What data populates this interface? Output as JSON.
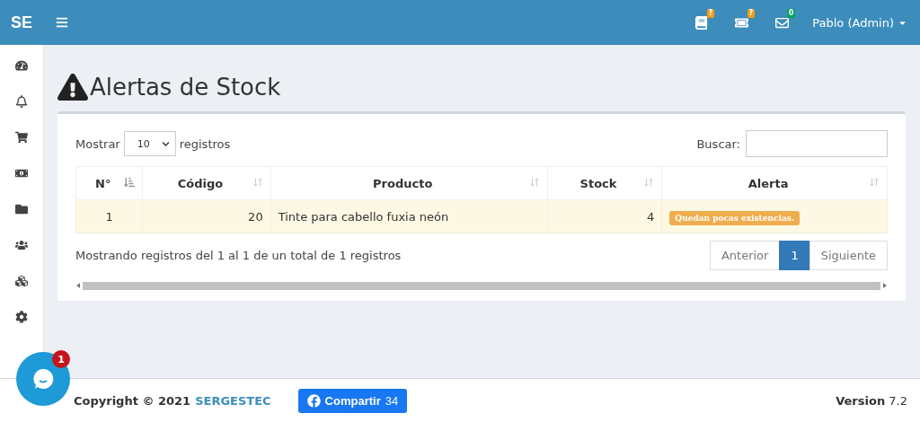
{
  "header": {
    "logo": "SE",
    "notifications": [
      {
        "kind": "book",
        "badge": "?",
        "color": "#f39c12"
      },
      {
        "kind": "ticket",
        "badge": "?",
        "color": "#f39c12"
      },
      {
        "kind": "mail",
        "badge": "0",
        "color": "#00a65a"
      }
    ],
    "user": "Pablo (Admin)"
  },
  "sidebar": {
    "items": [
      {
        "kind": "dashboard"
      },
      {
        "kind": "bell"
      },
      {
        "kind": "cart"
      },
      {
        "kind": "money"
      },
      {
        "kind": "folder"
      },
      {
        "kind": "users"
      },
      {
        "kind": "cubes"
      },
      {
        "kind": "gear"
      }
    ]
  },
  "page_title": "Alertas de Stock",
  "table_controls": {
    "show_label": "Mostrar",
    "page_size": "10",
    "show_suffix": "registros",
    "search_label": "Buscar:"
  },
  "table": {
    "columns": [
      {
        "label": "N°",
        "sorted": true
      },
      {
        "label": "Código",
        "sorted": false
      },
      {
        "label": "Producto",
        "sorted": false
      },
      {
        "label": "Stock",
        "sorted": false
      },
      {
        "label": "Alerta",
        "sorted": false
      }
    ],
    "rows": [
      {
        "cells": [
          "1",
          "20",
          "Tinte para cabello fuxia neón",
          "4"
        ],
        "alert": "Quedan pocas existencias."
      }
    ]
  },
  "info": "Mostrando registros del 1 al 1 de un total de 1 registros",
  "pagination": [
    {
      "label": "Anterior",
      "selected": false
    },
    {
      "label": "1",
      "selected": true
    },
    {
      "label": "Siguiente",
      "selected": false
    }
  ],
  "chat": {
    "badge": "1"
  },
  "footer": {
    "copyright": "Copyright © 2021",
    "brand": "SERGESTEC",
    "share_label": "Compartir",
    "share_count": "34",
    "version_label": "Version",
    "version": "7.2"
  }
}
